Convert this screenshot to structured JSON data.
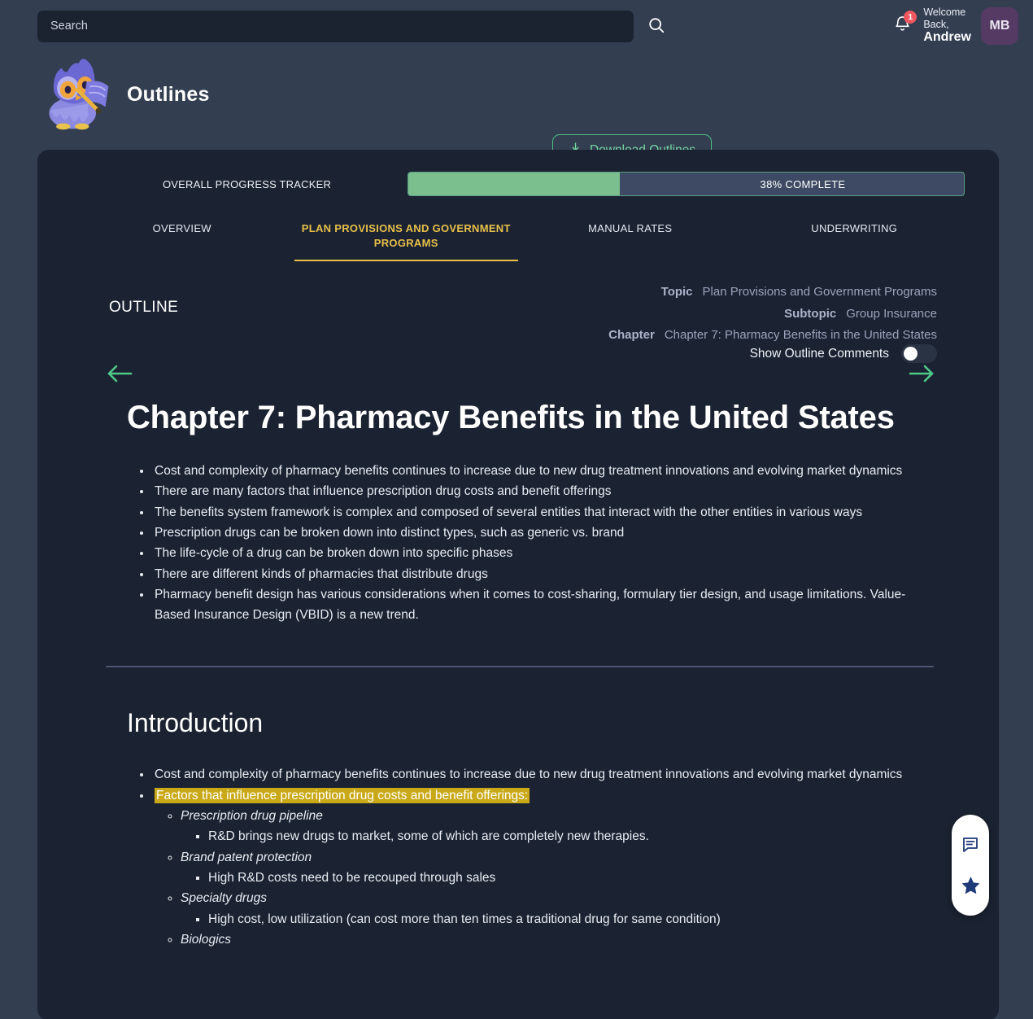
{
  "topbar": {
    "search_placeholder": "Search",
    "search_value": "",
    "search_icon": "search-icon",
    "bell_icon": "bell-icon",
    "notification_count": "1",
    "welcome_line1": "Welcome",
    "welcome_line2": "Back,",
    "user_name": "Andrew",
    "avatar_initials": "MB"
  },
  "header": {
    "logo_icon": "owl-mascot-logo",
    "title": "Outlines",
    "download_label": "Download Outlines",
    "download_icon": "download-icon"
  },
  "progress": {
    "label": "OVERALL PROGRESS TRACKER",
    "percent": 38,
    "percent_text": "38% COMPLETE",
    "fill_color": "#7bbf8e",
    "track_color": "#3e4a63"
  },
  "tabs": [
    {
      "label": "OVERVIEW",
      "active": false
    },
    {
      "label": "PLAN PROVISIONS AND GOVERNMENT PROGRAMS",
      "active": true
    },
    {
      "label": "MANUAL RATES",
      "active": false
    },
    {
      "label": "UNDERWRITING",
      "active": false
    }
  ],
  "tab_active_color": "#e8c04a",
  "outline_meta": {
    "heading": "OUTLINE",
    "rows": [
      {
        "key": "Topic",
        "value": "Plan Provisions and Government Programs"
      },
      {
        "key": "Subtopic",
        "value": "Group Insurance"
      },
      {
        "key": "Chapter",
        "value": "Chapter 7: Pharmacy Benefits in the United States"
      }
    ],
    "toggle_label": "Show Outline Comments",
    "toggle_on": false,
    "prev_icon": "arrow-left-icon",
    "next_icon": "arrow-right-icon",
    "arrow_color": "#4fc98a"
  },
  "chapter": {
    "title": "Chapter 7: Pharmacy Benefits in the United States",
    "bullets": [
      "Cost and complexity of pharmacy benefits continues to increase due to new drug treatment innovations and evolving market dynamics",
      "There are many factors that influence prescription drug costs and benefit offerings",
      "The benefits system framework is complex and composed of several entities that interact with the other entities in various ways",
      "Prescription drugs can be broken down into distinct types, such as generic vs. brand",
      "The life-cycle of a drug can be broken down into specific phases",
      "There are different kinds of pharmacies that distribute drugs",
      "Pharmacy benefit design has various considerations when it comes to cost-sharing, formulary tier design, and usage limitations. Value-Based Insurance Design (VBID) is a new trend."
    ]
  },
  "introduction": {
    "title": "Introduction",
    "bullet_1": "Cost and complexity of pharmacy benefits continues to increase due to new drug treatment innovations and evolving market dynamics",
    "bullet_2_highlighted": "Factors that influence prescription drug costs and benefit offerings:",
    "highlight_color": "#c9a917",
    "sub_items": [
      {
        "label": "Prescription drug pipeline",
        "detail": "R&D brings new drugs to market, some of which are completely new therapies."
      },
      {
        "label": "Brand patent protection",
        "detail": "High R&D costs need to be recouped through sales"
      },
      {
        "label": "Specialty drugs",
        "detail": "High cost, low utilization (can cost more than ten times a traditional drug for same condition)"
      },
      {
        "label": "Biologics",
        "detail": ""
      }
    ]
  },
  "floating_actions": {
    "comment_icon": "comment-icon",
    "favorite_icon": "star-icon",
    "icon_color": "#1f3a78"
  }
}
